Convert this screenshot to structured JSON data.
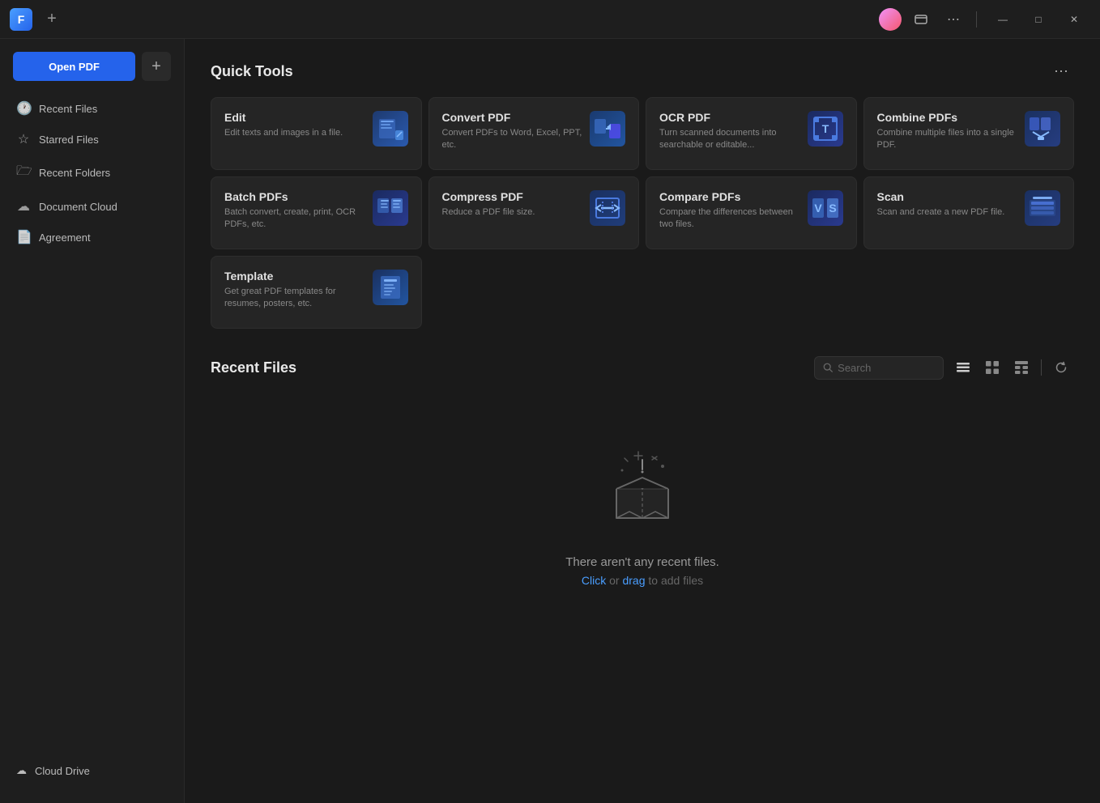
{
  "titlebar": {
    "app_logo": "F",
    "add_tab_label": "+",
    "menu_dots": "⋯",
    "window_minimize": "—",
    "window_maximize": "□",
    "window_close": "✕"
  },
  "sidebar": {
    "open_pdf_label": "Open PDF",
    "new_tab_label": "+",
    "nav_items": [
      {
        "id": "recent-files",
        "icon": "🕐",
        "label": "Recent Files"
      },
      {
        "id": "starred-files",
        "icon": "☆",
        "label": "Starred Files"
      },
      {
        "id": "recent-folders",
        "icon": "📁",
        "label": "Recent Folders"
      },
      {
        "id": "document-cloud",
        "icon": "☁",
        "label": "Document Cloud"
      },
      {
        "id": "agreement",
        "icon": "📄",
        "label": "Agreement"
      }
    ],
    "bottom_items": [
      {
        "id": "cloud-drive",
        "icon": "☁",
        "label": "Cloud Drive"
      }
    ]
  },
  "quick_tools": {
    "title": "Quick Tools",
    "more_icon": "⋯",
    "tools": [
      {
        "id": "edit",
        "title": "Edit",
        "desc": "Edit texts and images in a file."
      },
      {
        "id": "convert-pdf",
        "title": "Convert PDF",
        "desc": "Convert PDFs to Word, Excel, PPT, etc."
      },
      {
        "id": "ocr-pdf",
        "title": "OCR PDF",
        "desc": "Turn scanned documents into searchable or editable..."
      },
      {
        "id": "combine-pdfs",
        "title": "Combine PDFs",
        "desc": "Combine multiple files into a single PDF."
      },
      {
        "id": "batch-pdfs",
        "title": "Batch PDFs",
        "desc": "Batch convert, create, print, OCR PDFs, etc."
      },
      {
        "id": "compress-pdf",
        "title": "Compress PDF",
        "desc": "Reduce a PDF file size."
      },
      {
        "id": "compare-pdfs",
        "title": "Compare PDFs",
        "desc": "Compare the differences between two files."
      },
      {
        "id": "scan",
        "title": "Scan",
        "desc": "Scan and create a new PDF file."
      },
      {
        "id": "template",
        "title": "Template",
        "desc": "Get great PDF templates for resumes, posters, etc."
      }
    ]
  },
  "recent_files": {
    "title": "Recent Files",
    "search_placeholder": "Search",
    "empty_main": "There aren't any recent files.",
    "empty_click": "Click",
    "empty_or": " or ",
    "empty_drag": "drag",
    "empty_add": " to add files"
  }
}
